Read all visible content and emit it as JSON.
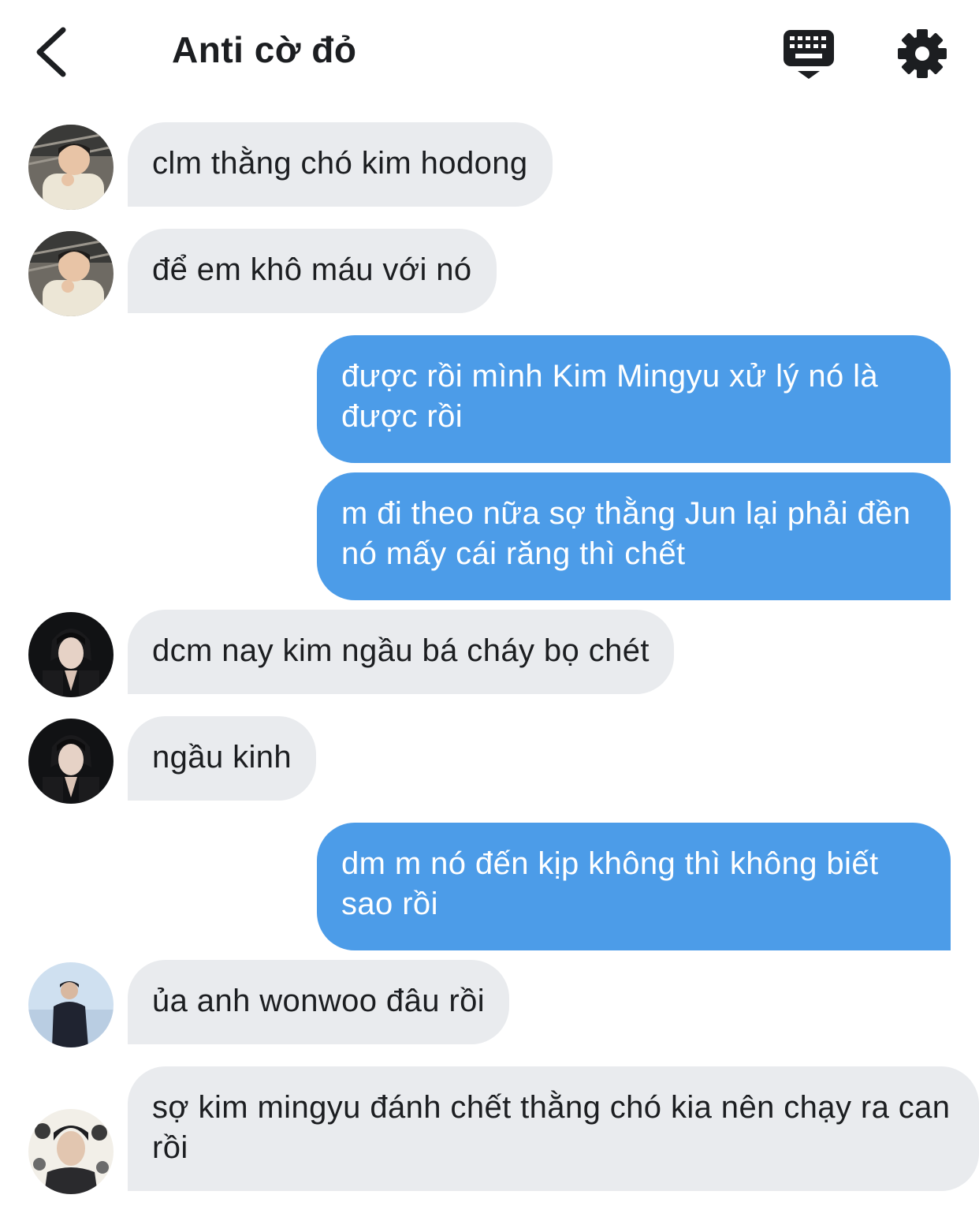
{
  "header": {
    "title": "Anti cờ đỏ",
    "back_icon": "chevron-left-icon",
    "keyboard_icon": "keyboard-icon",
    "settings_icon": "gear-icon"
  },
  "colors": {
    "incoming_bubble": "#e9ebee",
    "outgoing_bubble": "#4c9ce8",
    "text": "#1c1e21"
  },
  "messages": [
    {
      "direction": "incoming",
      "sender": "avatar-1",
      "text": "clm thằng chó kim hodong"
    },
    {
      "direction": "incoming",
      "sender": "avatar-1",
      "text": "để em khô máu với nó"
    },
    {
      "direction": "outgoing",
      "text": "được rồi mình Kim Mingyu xử lý nó là được rồi"
    },
    {
      "direction": "outgoing",
      "text": "m đi theo nữa sợ thằng Jun lại phải đền nó mấy cái răng thì chết"
    },
    {
      "direction": "incoming",
      "sender": "avatar-2",
      "text": "dcm nay kim ngầu bá cháy bọ chét"
    },
    {
      "direction": "incoming",
      "sender": "avatar-2",
      "text": "ngầu kinh"
    },
    {
      "direction": "outgoing",
      "text": "dm m nó đến kịp không thì không biết sao rồi"
    },
    {
      "direction": "incoming",
      "sender": "avatar-3",
      "text": "ủa anh wonwoo đâu rồi"
    },
    {
      "direction": "incoming",
      "sender": "avatar-4",
      "text": "sợ kim mingyu đánh chết thằng chó kia nên chạy ra can rồi"
    }
  ]
}
